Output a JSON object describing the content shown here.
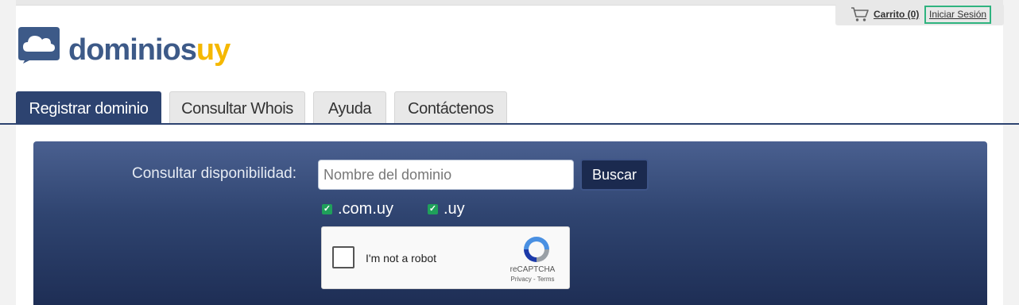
{
  "header": {
    "cart_label": "Carrito (0)",
    "login_label": "Iniciar Sesión",
    "logo_primary": "dominios",
    "logo_accent": "uy"
  },
  "tabs": [
    {
      "label": "Registrar dominio",
      "active": true
    },
    {
      "label": "Consultar Whois",
      "active": false
    },
    {
      "label": "Ayuda",
      "active": false
    },
    {
      "label": "Contáctenos",
      "active": false
    }
  ],
  "search": {
    "label": "Consultar disponibilidad:",
    "placeholder": "Nombre del dominio",
    "value": "",
    "button_label": "Buscar"
  },
  "tlds": [
    {
      "label": ".com.uy",
      "checked": true
    },
    {
      "label": ".uy",
      "checked": true
    }
  ],
  "captcha": {
    "label": "I'm not a robot",
    "brand": "reCAPTCHA",
    "links": "Privacy - Terms"
  },
  "colors": {
    "brand_blue": "#3d5a88",
    "brand_yellow": "#f5b800",
    "tab_active": "#2d4370",
    "login_highlight": "#2fb37f",
    "checkbox_green": "#1fa05a"
  },
  "icons": [
    "cart-icon",
    "cloud-logo-icon",
    "recaptcha-logo-icon",
    "checkmark-icon"
  ]
}
